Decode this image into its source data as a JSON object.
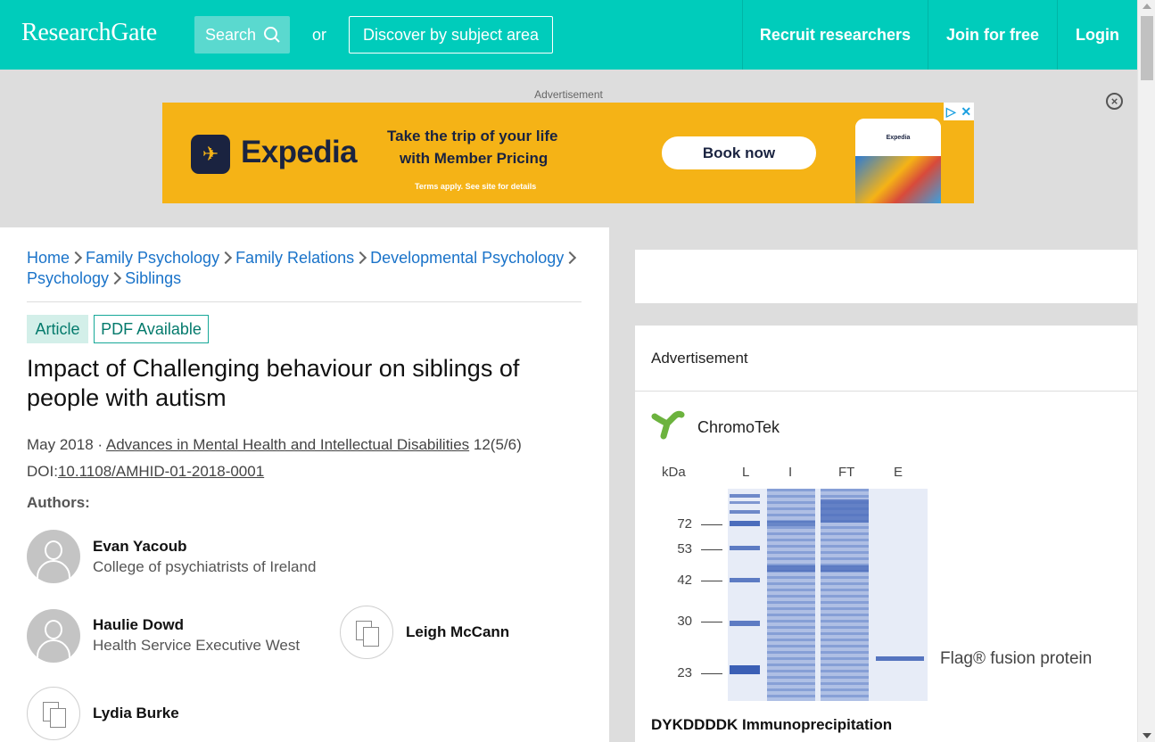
{
  "header": {
    "logo": "ResearchGate",
    "search_label": "Search",
    "or_text": "or",
    "discover_label": "Discover by subject area",
    "nav": [
      "Recruit researchers",
      "Join for free",
      "Login"
    ]
  },
  "top_ad": {
    "label": "Advertisement",
    "close_symbol": "×",
    "brand": "Expedia",
    "tagline_line1": "Take the trip of your life",
    "tagline_line2": "with Member Pricing",
    "terms": "Terms apply. See site for details",
    "cta": "Book now",
    "phone_brand": "Expedia",
    "adchoices_icon": "▷",
    "adchoices_close": "✕"
  },
  "article": {
    "breadcrumb": [
      "Home",
      "Family Psychology",
      "Family Relations",
      "Developmental Psychology",
      "Psychology",
      "Siblings"
    ],
    "badge_type": "Article",
    "badge_pdf": "PDF Available",
    "title": "Impact of Challenging behaviour on siblings of people with autism",
    "date": "May 2018",
    "dot": "·",
    "journal": "Advances in Mental Health and Intellectual Disabilities",
    "issue": "12(5/6)",
    "doi_label": "DOI:",
    "doi": "10.1108/AMHID-01-2018-0001",
    "authors_label": "Authors:",
    "authors": [
      {
        "name": "Evan Yacoub",
        "affiliation": "College of psychiatrists of Ireland"
      },
      {
        "name": "Haulie Dowd",
        "affiliation": "Health Service Executive West"
      },
      {
        "name": "Leigh McCann",
        "affiliation": ""
      },
      {
        "name": "Lydia Burke",
        "affiliation": ""
      }
    ]
  },
  "side_ad": {
    "label": "Advertisement",
    "brand": "ChromoTek",
    "kda_label": "kDa",
    "lanes": [
      "L",
      "I",
      "FT",
      "E"
    ],
    "markers": [
      "72",
      "53",
      "42",
      "30",
      "23"
    ],
    "flag_label": "Flag® fusion protein",
    "caption": "DYKDDDDK Immunoprecipitation"
  },
  "colors": {
    "brand_teal": "#00ccbb",
    "link_blue": "#1a73c9",
    "expedia_yellow": "#f5b316",
    "expedia_navy": "#1a2340"
  }
}
